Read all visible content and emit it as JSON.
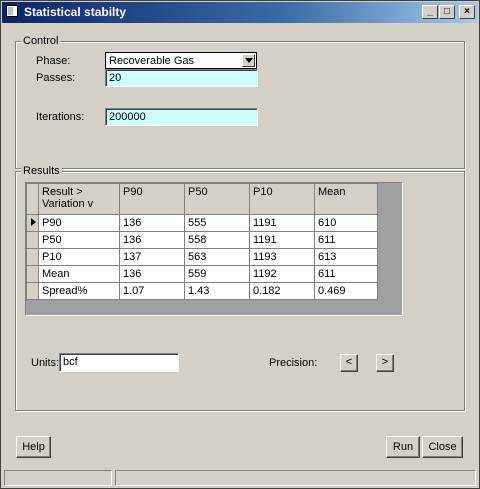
{
  "window": {
    "title": "Statistical stabilty"
  },
  "title_buttons": {
    "minimize": "_",
    "maximize": "□",
    "close": "×"
  },
  "control": {
    "legend": "Control",
    "phase_label": "Phase:",
    "phase_value": "Recoverable Gas",
    "passes_label": "Passes:",
    "passes_value": "20",
    "iterations_label": "Iterations:",
    "iterations_value": "200000"
  },
  "results": {
    "legend": "Results",
    "header": [
      "Result >\nVariation v",
      "P90",
      "P50",
      "P10",
      "Mean"
    ],
    "rows": [
      [
        "P90",
        "136",
        "555",
        "1191",
        "610"
      ],
      [
        "P50",
        "136",
        "558",
        "1191",
        "611"
      ],
      [
        "P10",
        "137",
        "563",
        "1193",
        "613"
      ],
      [
        "Mean",
        "136",
        "559",
        "1192",
        "611"
      ],
      [
        "Spread%",
        "1.07",
        "1.43",
        "0.182",
        "0.469"
      ]
    ],
    "selected_row": 0
  },
  "units": {
    "label": "Units:",
    "value": "bcf"
  },
  "precision": {
    "label": "Precision:",
    "decrease": "<",
    "increase": ">"
  },
  "buttons": {
    "help": "Help",
    "run": "Run",
    "close": "Close"
  },
  "icons": {
    "app": "window-app-icon",
    "minimize": "minimize-icon",
    "maximize": "maximize-icon",
    "close": "close-icon",
    "dropdown": "dropdown-arrow-icon",
    "row_pointer": "row-pointer-icon"
  }
}
